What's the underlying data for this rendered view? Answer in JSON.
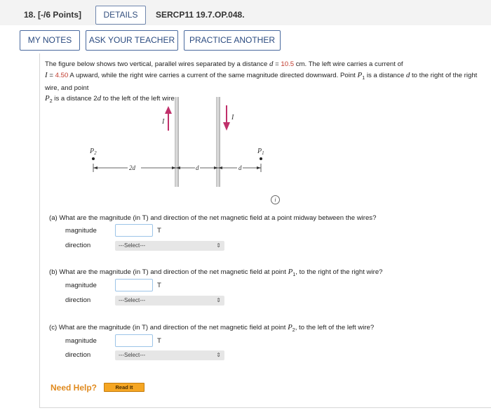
{
  "question": {
    "number": "18.",
    "points": "[-/6 Points]",
    "details_button": "DETAILS",
    "code": "SERCP11 19.7.OP.048."
  },
  "toolbar": {
    "notes": "MY NOTES",
    "ask": "ASK YOUR TEACHER",
    "practice": "PRACTICE ANOTHER"
  },
  "intro": {
    "t1": "The figure below shows two vertical, parallel wires separated by a distance ",
    "d_sym": "d",
    "t2": " = ",
    "d_val": "10.5",
    "t3": " cm. The left wire carries a current of",
    "i_sym": "I",
    "t4": " = ",
    "i_val": "4.50",
    "t5": " A upward, while the right wire carries a current of the same magnitude directed downward. Point ",
    "p1": "P",
    "p1_sub": "1",
    "t6": " is a distance ",
    "d2": "d",
    "t7": " to the right of the right wire, and point ",
    "p2": "P",
    "p2_sub": "2",
    "t8": " is a distance 2",
    "d3": "d",
    "t9": " to the left of the left wire."
  },
  "figure": {
    "label_I_left": "I",
    "label_I_right": "I",
    "label_P1": "P",
    "label_P1_sub": "1",
    "label_P2": "P",
    "label_P2_sub": "2",
    "dim_2d": "2d",
    "dim_d_mid": "d",
    "dim_d_right": "d",
    "info_symbol": "i"
  },
  "parts": [
    {
      "q_prefix": "(a)  What are the magnitude (in T) and direction of the net magnetic field at a point midway between the wires?",
      "q_mid": "",
      "q_sub": "",
      "q_suffix": "",
      "magnitude_label": "magnitude",
      "unit": "T",
      "direction_label": "direction",
      "select_value": "---Select---"
    },
    {
      "q_prefix": "(b)  What are the magnitude (in T) and direction of the net magnetic field at point ",
      "q_mid": "P",
      "q_sub": "1",
      "q_suffix": ", to the right of the right wire?",
      "magnitude_label": "magnitude",
      "unit": "T",
      "direction_label": "direction",
      "select_value": "---Select---"
    },
    {
      "q_prefix": "(c)  What are the magnitude (in T) and direction of the net magnetic field at point ",
      "q_mid": "P",
      "q_sub": "2",
      "q_suffix": ", to the left of the left wire?",
      "magnitude_label": "magnitude",
      "unit": "T",
      "direction_label": "direction",
      "select_value": "---Select---"
    }
  ],
  "help": {
    "need_help": "Need Help?",
    "read_it": "Read It"
  },
  "colors": {
    "accent_red": "#c0392b",
    "arrow": "#c0306a",
    "button_border": "#4a6a9e",
    "help_orange": "#e08a1e"
  }
}
